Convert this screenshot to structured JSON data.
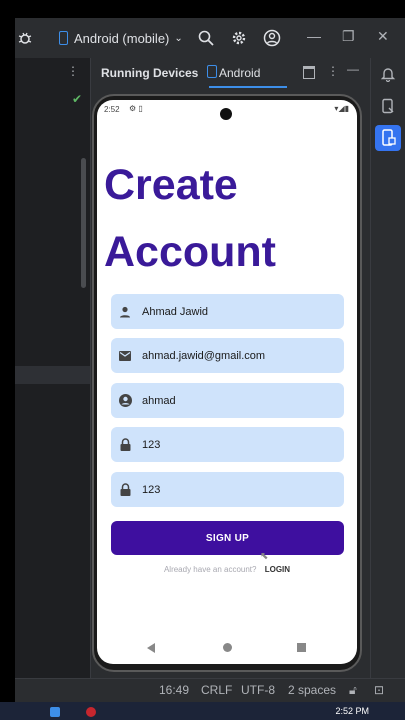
{
  "ide": {
    "device_selector": "Android (mobile)",
    "panel_title": "Running Devices",
    "panel_tab": "Android",
    "status": {
      "position": "16:49",
      "line_ending": "CRLF",
      "encoding": "UTF-8",
      "indent": "2 spaces"
    }
  },
  "taskbar": {
    "clock": "2:52 PM"
  },
  "phone": {
    "status_time": "2:52",
    "heading_line1": "Create",
    "heading_line2": "Account",
    "fields": [
      {
        "icon": "person-icon",
        "value": "Ahmad Jawid"
      },
      {
        "icon": "email-icon",
        "value": "ahmad.jawid@gmail.com"
      },
      {
        "icon": "account-circle-icon",
        "value": "ahmad"
      },
      {
        "icon": "lock-icon",
        "value": "123"
      },
      {
        "icon": "lock-icon",
        "value": "123"
      }
    ],
    "signup_label": "SIGN UP",
    "login_prompt": "Already have an account?",
    "login_link": "LOGIN"
  },
  "colors": {
    "heading": "#3a1a99",
    "button": "#3e0f9f",
    "field_bg": "#cfe3fb",
    "ide_bg": "#2b2d30",
    "accent": "#3d8ee8"
  }
}
